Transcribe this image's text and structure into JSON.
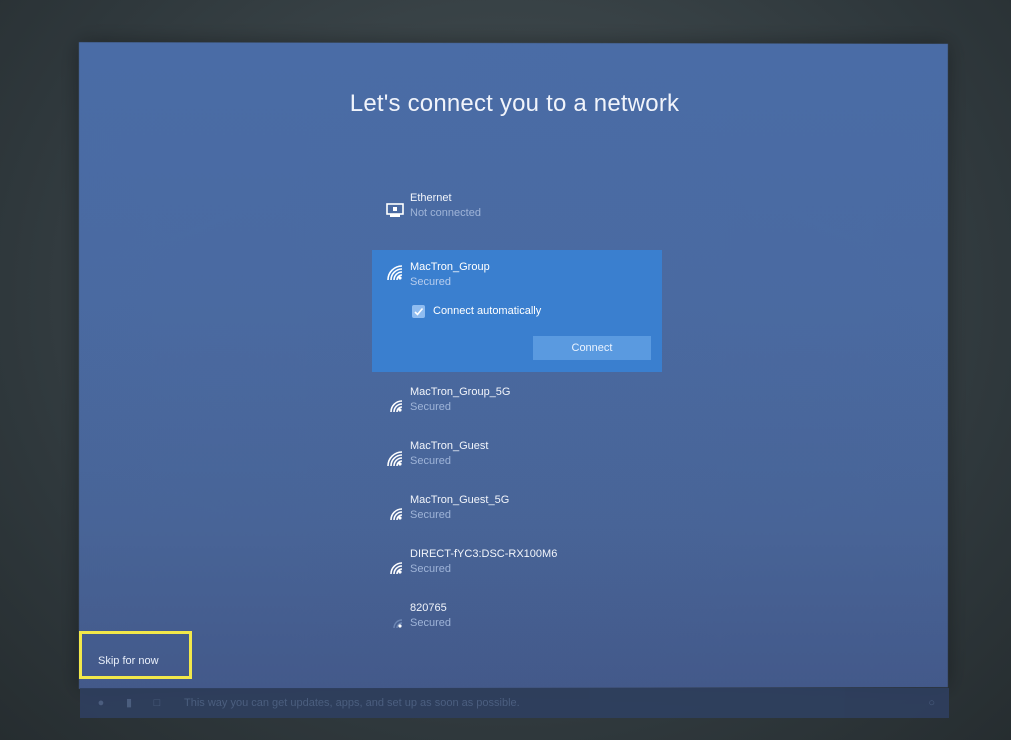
{
  "title": "Let's connect you to a network",
  "ethernet": {
    "name": "Ethernet",
    "status": "Not connected"
  },
  "selected_network": {
    "name": "MacTron_Group",
    "status": "Secured",
    "connect_automatically_label": "Connect automatically",
    "connect_automatically_checked": true,
    "connect_button": "Connect"
  },
  "networks": [
    {
      "name": "MacTron_Group_5G",
      "status": "Secured",
      "icon": "wifi-secured-icon"
    },
    {
      "name": "MacTron_Guest",
      "status": "Secured",
      "icon": "wifi-secured-icon"
    },
    {
      "name": "MacTron_Guest_5G",
      "status": "Secured",
      "icon": "wifi-secured-icon"
    },
    {
      "name": "DIRECT-fYC3:DSC-RX100M6",
      "status": "Secured",
      "icon": "wifi-secured-icon"
    },
    {
      "name": "820765",
      "status": "Secured",
      "icon": "wifi-weak-icon"
    }
  ],
  "skip_label": "Skip for now",
  "taskbar": {
    "tip_text": "This way you can get updates, apps, and set up as soon as possible."
  },
  "colors": {
    "screen_bg": "#4a6ca6",
    "selected_bg": "#3a7fcf",
    "button_bg": "#5a9ae0",
    "highlight": "#f2e84a"
  }
}
